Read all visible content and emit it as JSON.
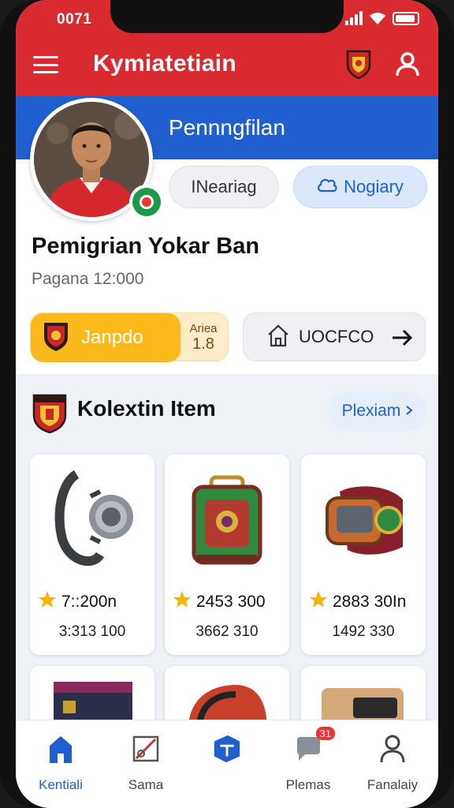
{
  "status_bar": {
    "time": "0071"
  },
  "app_bar": {
    "title": "Kymiatetiain"
  },
  "banner": {
    "title": "Pennngfilan"
  },
  "profile": {
    "name": "Pemigrian Yokar Ban",
    "subtitle": "Pagana 12:000",
    "following_label": "INeariag",
    "follow_label": "Nogiary"
  },
  "actions": {
    "join_label": "Janpdo",
    "join_side_top": "Ariea",
    "join_side_bottom": "1.8",
    "voucher_label": "UOCFCO"
  },
  "collection": {
    "title": "Kolextin Item",
    "premium_label": "Plexiam",
    "items": [
      {
        "price": "7::200n",
        "sub": "3:313 100",
        "icon": "smartwatch-icon"
      },
      {
        "price": "2453 300",
        "sub": "3662 310",
        "icon": "backpack-icon"
      },
      {
        "price": "2883 30In",
        "sub": "1492 330",
        "icon": "gadget-icon"
      }
    ]
  },
  "bottom_nav": {
    "items": [
      {
        "label": "Kentiali",
        "icon": "home-icon",
        "active": true
      },
      {
        "label": "Sama",
        "icon": "pitch-icon"
      },
      {
        "label": "",
        "icon": "store-icon"
      },
      {
        "label": "Plemas",
        "icon": "chat-icon",
        "badge": "31"
      },
      {
        "label": "Fanalaiy",
        "icon": "profile-icon"
      }
    ]
  },
  "colors": {
    "primary_red": "#d92b2f",
    "primary_blue": "#1f5fd0",
    "gold": "#fbb91b",
    "star": "#f7b500"
  }
}
